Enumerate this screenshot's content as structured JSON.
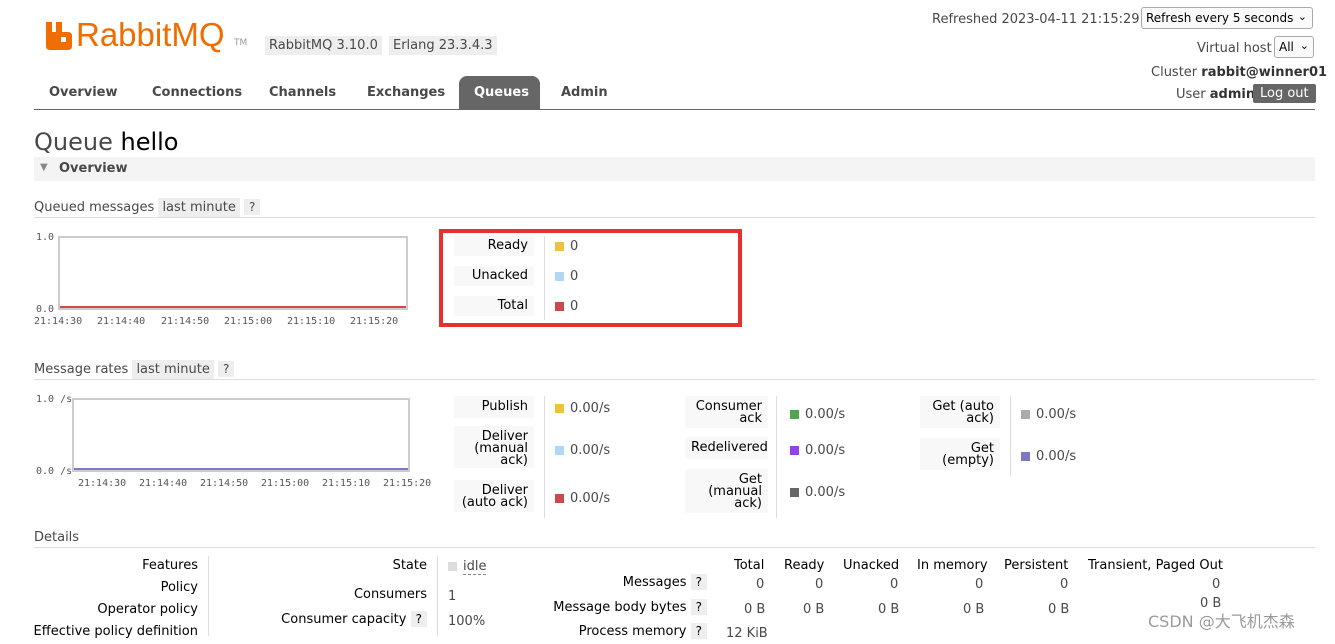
{
  "header": {
    "logo_text": "RabbitMQ",
    "logo_tm": "TM",
    "version_badge": "RabbitMQ 3.10.0",
    "erlang_badge": "Erlang 23.3.4.3",
    "refreshed_label": "Refreshed 2023-04-11 21:15:29",
    "refresh_select": "Refresh every 5 seconds",
    "vhost_label": "Virtual host",
    "vhost_select": "All",
    "cluster_label": "Cluster",
    "cluster_name": "rabbit@winner01",
    "user_label": "User",
    "user_name": "admin",
    "logout_label": "Log out"
  },
  "nav": {
    "tabs": [
      {
        "label": "Overview"
      },
      {
        "label": "Connections"
      },
      {
        "label": "Channels"
      },
      {
        "label": "Exchanges"
      },
      {
        "label": "Queues"
      },
      {
        "label": "Admin"
      }
    ],
    "active": "Queues"
  },
  "page": {
    "title_prefix": "Queue",
    "title_name": "hello",
    "section_overview": "Overview"
  },
  "queued": {
    "title": "Queued messages",
    "range": "last minute",
    "help": "?",
    "y_top": "1.0",
    "y_bottom": "0.0",
    "x_ticks": [
      "21:14:30",
      "21:14:40",
      "21:14:50",
      "21:15:00",
      "21:15:10",
      "21:15:20"
    ],
    "legend": [
      {
        "label": "Ready",
        "value": "0",
        "color": "#EDC240"
      },
      {
        "label": "Unacked",
        "value": "0",
        "color": "#AFD8F8"
      },
      {
        "label": "Total",
        "value": "0",
        "color": "#CB4B4B"
      }
    ]
  },
  "rates": {
    "title": "Message rates",
    "range": "last minute",
    "help": "?",
    "y_top": "1.0 /s",
    "y_bottom": "0.0 /s",
    "x_ticks": [
      "21:14:30",
      "21:14:40",
      "21:14:50",
      "21:15:00",
      "21:15:10",
      "21:15:20"
    ],
    "col1": [
      {
        "label": "Publish",
        "value": "0.00/s",
        "color": "#EDC240"
      },
      {
        "label": "Deliver (manual ack)",
        "value": "0.00/s",
        "color": "#AFD8F8"
      },
      {
        "label": "Deliver (auto ack)",
        "value": "0.00/s",
        "color": "#CB4B4B"
      }
    ],
    "col2": [
      {
        "label": "Consumer ack",
        "value": "0.00/s",
        "color": "#4DA74D"
      },
      {
        "label": "Redelivered",
        "value": "0.00/s",
        "color": "#9440ED"
      },
      {
        "label": "Get (manual ack)",
        "value": "0.00/s",
        "color": "#666666"
      }
    ],
    "col3": [
      {
        "label": "Get (auto ack)",
        "value": "0.00/s",
        "color": "#AAAAAA"
      },
      {
        "label": "Get (empty)",
        "value": "0.00/s",
        "color": "#7C79C3"
      }
    ]
  },
  "details": {
    "title": "Details",
    "left_labels": [
      "Features",
      "Policy",
      "Operator policy",
      "Effective policy definition"
    ],
    "state_label": "State",
    "state_value": "idle",
    "consumers_label": "Consumers",
    "consumers_value": "1",
    "capacity_label": "Consumer capacity",
    "capacity_value": "100%",
    "help": "?",
    "table_headers": [
      "Total",
      "Ready",
      "Unacked",
      "In memory",
      "Persistent",
      "Transient, Paged Out"
    ],
    "rows": [
      {
        "label": "Messages",
        "values": [
          "0",
          "0",
          "0",
          "0",
          "0",
          "0"
        ]
      },
      {
        "label": "Message body bytes",
        "values": [
          "0 B",
          "0 B",
          "0 B",
          "0 B",
          "0 B",
          "0 B"
        ]
      },
      {
        "label": "Process memory",
        "values": [
          "12 KiB"
        ]
      }
    ]
  },
  "watermark": "CSDN @大飞机杰森",
  "colors": {
    "brand": "#F06D00",
    "active_tab": "#666666",
    "highlight_box": "#E8302E"
  }
}
